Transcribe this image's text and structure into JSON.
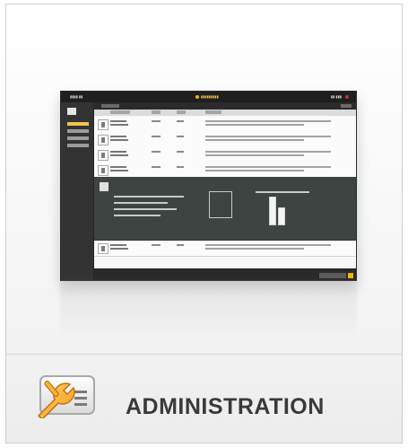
{
  "tile": {
    "label": "ADMINISTRATION",
    "icon": "wrench-checklist-icon"
  },
  "preview": {
    "title": "administration-screenshot"
  }
}
